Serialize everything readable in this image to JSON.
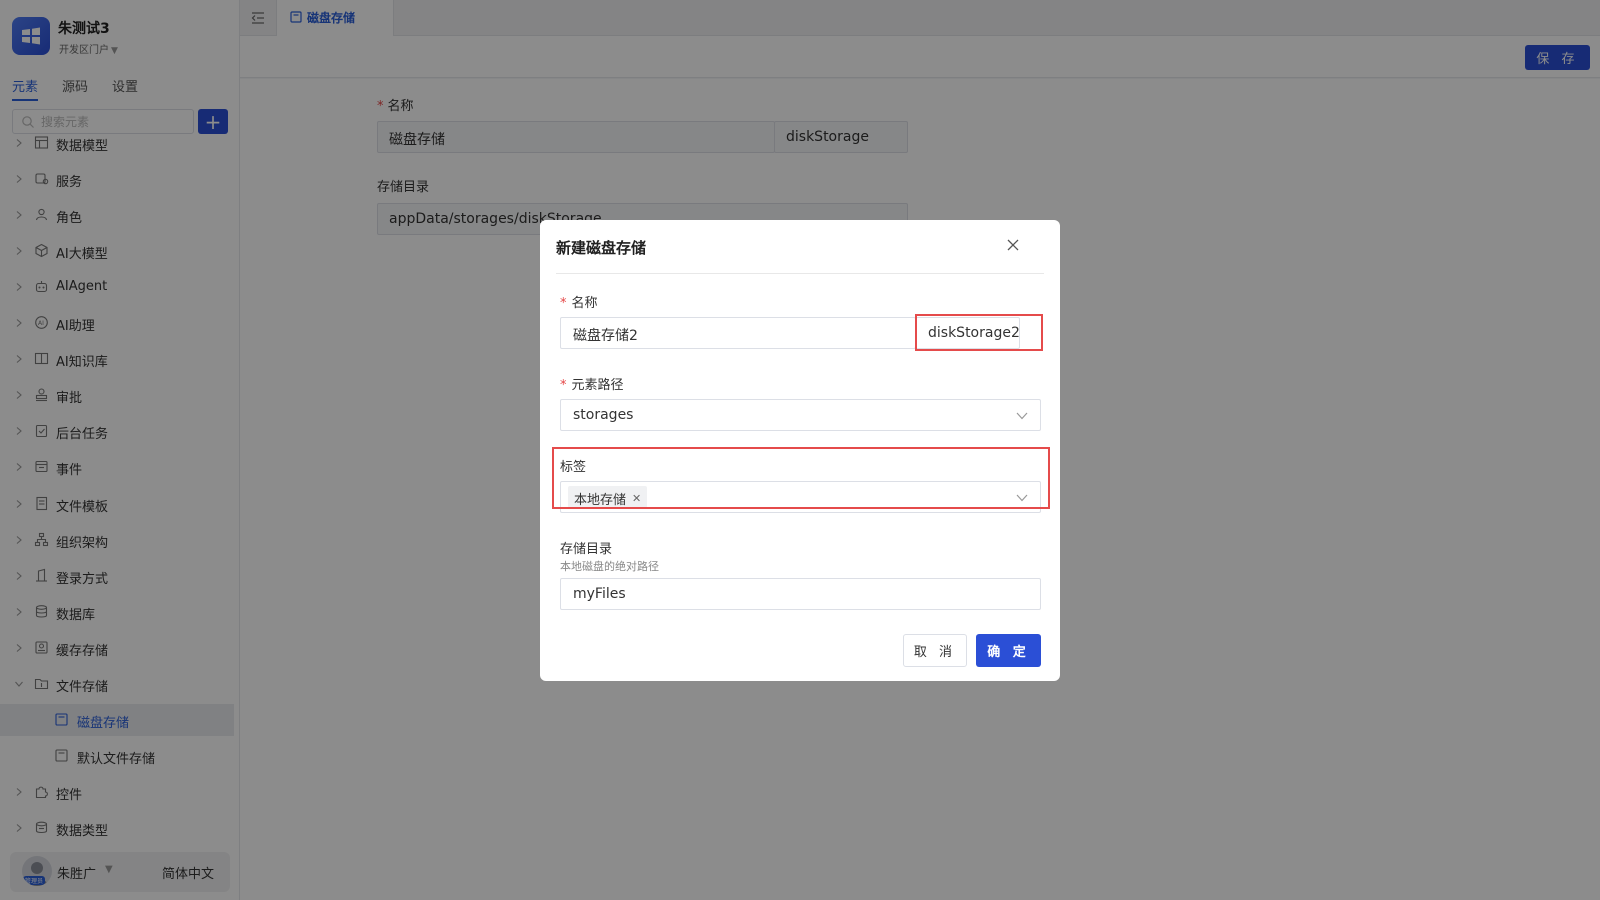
{
  "app": {
    "name": "朱测试3",
    "portal": "开发区门户",
    "logo_icon": "windows-grid-icon",
    "accent": "#2b4fd6"
  },
  "sidebar": {
    "tabs": [
      {
        "label": "元素",
        "active": true
      },
      {
        "label": "源码",
        "active": false
      },
      {
        "label": "设置",
        "active": false
      }
    ],
    "search_placeholder": "搜索元素",
    "add_label": "+",
    "tree": [
      {
        "label": "数据模型",
        "icon": "table-icon"
      },
      {
        "label": "服务",
        "icon": "service-icon"
      },
      {
        "label": "角色",
        "icon": "role-icon"
      },
      {
        "label": "AI大模型",
        "icon": "cube-icon"
      },
      {
        "label": "AIAgent",
        "icon": "robot-icon"
      },
      {
        "label": "AI助理",
        "icon": "ai-assistant-icon"
      },
      {
        "label": "AI知识库",
        "icon": "book-icon"
      },
      {
        "label": "审批",
        "icon": "stamp-icon"
      },
      {
        "label": "后台任务",
        "icon": "clipboard-icon"
      },
      {
        "label": "事件",
        "icon": "event-icon"
      },
      {
        "label": "文件模板",
        "icon": "file-template-icon"
      },
      {
        "label": "组织架构",
        "icon": "org-chart-icon"
      },
      {
        "label": "登录方式",
        "icon": "login-icon"
      },
      {
        "label": "数据库",
        "icon": "database-icon"
      },
      {
        "label": "缓存存储",
        "icon": "cache-icon"
      },
      {
        "label": "文件存储",
        "icon": "folder-icon",
        "expanded": true
      },
      {
        "label": "磁盘存储",
        "icon": "disk-icon",
        "child": true,
        "selected": true
      },
      {
        "label": "默认文件存储",
        "icon": "disk-icon",
        "child": true
      },
      {
        "label": "控件",
        "icon": "puzzle-icon"
      },
      {
        "label": "数据类型",
        "icon": "data-type-icon"
      }
    ],
    "user": {
      "name": "朱胜广",
      "role_badge": "管理员",
      "language": "简体中文"
    }
  },
  "topbar": {
    "tab_label": "磁盘存储",
    "save_label": "保 存"
  },
  "page_form": {
    "name_label": "名称",
    "name_value": "磁盘存储",
    "code_value": "diskStorage",
    "dir_label": "存储目录",
    "dir_value": "appData/storages/diskStorage"
  },
  "modal": {
    "title": "新建磁盘存储",
    "name_label": "名称",
    "name_value": "磁盘存储2",
    "code_value": "diskStorage2",
    "path_label": "元素路径",
    "path_value": "storages",
    "tags_label": "标签",
    "tags": [
      "本地存储"
    ],
    "dir_label": "存储目录",
    "dir_hint": "本地磁盘的绝对路径",
    "dir_value": "myFiles",
    "cancel_label": "取 消",
    "ok_label": "确 定",
    "highlight_color": "#e54b4b"
  }
}
